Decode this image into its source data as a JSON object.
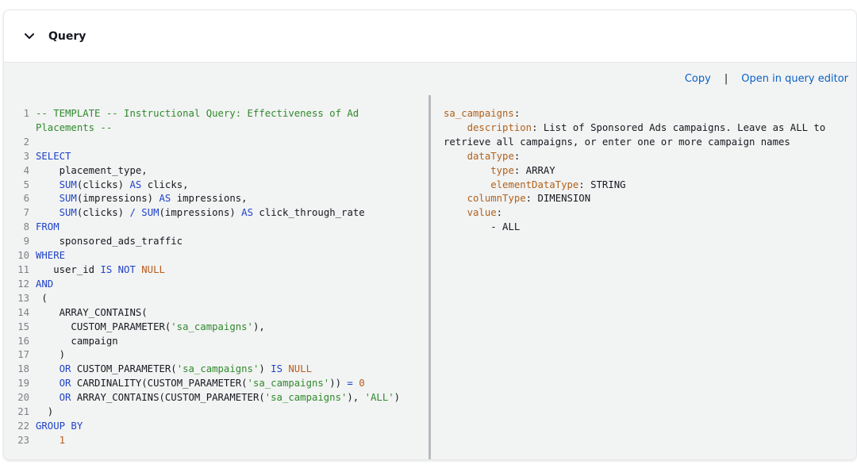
{
  "header": {
    "title": "Query",
    "toggle_icon": "chevron-down-icon"
  },
  "toolbar": {
    "copy_label": "Copy",
    "separator": "|",
    "open_label": "Open in query editor"
  },
  "sql": {
    "lines": [
      [
        [
          "c",
          "-- TEMPLATE -- Instructional Query: Effectiveness of Ad"
        ]
      ],
      [
        [
          "c",
          "Placements --"
        ]
      ],
      [
        [
          "t",
          ""
        ]
      ],
      [
        [
          "k",
          "SELECT"
        ]
      ],
      [
        [
          "t",
          "    placement_type,"
        ]
      ],
      [
        [
          "t",
          "    "
        ],
        [
          "k",
          "SUM"
        ],
        [
          "t",
          "(clicks) "
        ],
        [
          "k",
          "AS"
        ],
        [
          "t",
          " clicks,"
        ]
      ],
      [
        [
          "t",
          "    "
        ],
        [
          "k",
          "SUM"
        ],
        [
          "t",
          "(impressions) "
        ],
        [
          "k",
          "AS"
        ],
        [
          "t",
          " impressions,"
        ]
      ],
      [
        [
          "t",
          "    "
        ],
        [
          "k",
          "SUM"
        ],
        [
          "t",
          "(clicks) "
        ],
        [
          "k",
          "/"
        ],
        [
          "t",
          " "
        ],
        [
          "k",
          "SUM"
        ],
        [
          "t",
          "(impressions) "
        ],
        [
          "k",
          "AS"
        ],
        [
          "t",
          " click_through_rate"
        ]
      ],
      [
        [
          "k",
          "FROM"
        ]
      ],
      [
        [
          "t",
          "    sponsored_ads_traffic"
        ]
      ],
      [
        [
          "k",
          "WHERE"
        ]
      ],
      [
        [
          "t",
          "   user_id "
        ],
        [
          "k",
          "IS NOT"
        ],
        [
          "t",
          " "
        ],
        [
          "n",
          "NULL"
        ]
      ],
      [
        [
          "k",
          "AND"
        ]
      ],
      [
        [
          "t",
          " ("
        ]
      ],
      [
        [
          "t",
          "    ARRAY_CONTAINS("
        ]
      ],
      [
        [
          "t",
          "      CUSTOM_PARAMETER("
        ],
        [
          "s",
          "'sa_campaigns'"
        ],
        [
          "t",
          "),"
        ]
      ],
      [
        [
          "t",
          "      campaign"
        ]
      ],
      [
        [
          "t",
          "    )"
        ]
      ],
      [
        [
          "t",
          "    "
        ],
        [
          "k",
          "OR"
        ],
        [
          "t",
          " CUSTOM_PARAMETER("
        ],
        [
          "s",
          "'sa_campaigns'"
        ],
        [
          "t",
          ") "
        ],
        [
          "k",
          "IS"
        ],
        [
          "t",
          " "
        ],
        [
          "n",
          "NULL"
        ]
      ],
      [
        [
          "t",
          "    "
        ],
        [
          "k",
          "OR"
        ],
        [
          "t",
          " CARDINALITY(CUSTOM_PARAMETER("
        ],
        [
          "s",
          "'sa_campaigns'"
        ],
        [
          "t",
          ")) "
        ],
        [
          "k",
          "="
        ],
        [
          "t",
          " "
        ],
        [
          "n",
          "0"
        ]
      ],
      [
        [
          "t",
          "    "
        ],
        [
          "k",
          "OR"
        ],
        [
          "t",
          " ARRAY_CONTAINS(CUSTOM_PARAMETER("
        ],
        [
          "s",
          "'sa_campaigns'"
        ],
        [
          "t",
          "), "
        ],
        [
          "s",
          "'ALL'"
        ],
        [
          "t",
          ")"
        ]
      ],
      [
        [
          "t",
          "  )"
        ]
      ],
      [
        [
          "k",
          "GROUP BY"
        ]
      ],
      [
        [
          "t",
          "    "
        ],
        [
          "n",
          "1"
        ]
      ]
    ],
    "line_numbers": [
      "1",
      "",
      "2",
      "3",
      "4",
      "5",
      "6",
      "7",
      "8",
      "9",
      "10",
      "11",
      "12",
      "13",
      "14",
      "15",
      "16",
      "17",
      "18",
      "19",
      "20",
      "21",
      "22",
      "23"
    ]
  },
  "yaml": {
    "lines": [
      [
        [
          "y",
          "sa_campaigns"
        ],
        [
          "t",
          ":"
        ]
      ],
      [
        [
          "t",
          "    "
        ],
        [
          "y",
          "description"
        ],
        [
          "t",
          ": List of Sponsored Ads campaigns. Leave as ALL to retrieve all campaigns, or enter one or more campaign names"
        ]
      ],
      [
        [
          "t",
          "    "
        ],
        [
          "y",
          "dataType"
        ],
        [
          "t",
          ":"
        ]
      ],
      [
        [
          "t",
          "        "
        ],
        [
          "y",
          "type"
        ],
        [
          "t",
          ": ARRAY"
        ]
      ],
      [
        [
          "t",
          "        "
        ],
        [
          "y",
          "elementDataType"
        ],
        [
          "t",
          ": STRING"
        ]
      ],
      [
        [
          "t",
          "    "
        ],
        [
          "y",
          "columnType"
        ],
        [
          "t",
          ": DIMENSION"
        ]
      ],
      [
        [
          "t",
          "    "
        ],
        [
          "y",
          "value"
        ],
        [
          "t",
          ":"
        ]
      ],
      [
        [
          "t",
          "        - ALL"
        ]
      ]
    ]
  },
  "colors": {
    "keyword": "#1f43c8",
    "comment": "#2f8a2c",
    "string": "#2f8a2c",
    "number": "#b85d1e",
    "yaml_key": "#b0621c",
    "link": "#0a62c8"
  }
}
